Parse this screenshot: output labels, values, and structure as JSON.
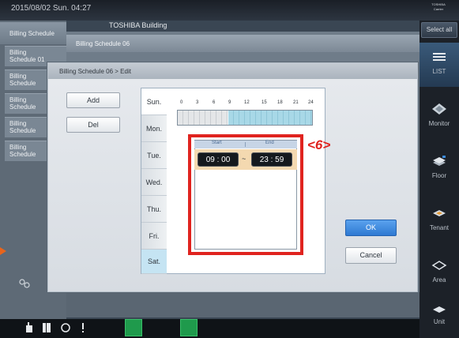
{
  "topbar": {
    "datetime": "2015/08/02  Sun.  04:27",
    "building": "TOSHIBA Building",
    "logo_lines": [
      "TOSHIBA",
      "Carrier"
    ]
  },
  "right_panel": {
    "select_all": "Select all",
    "nav": [
      {
        "label": "LIST",
        "icon": "list-icon"
      },
      {
        "label": "Monitor",
        "icon": "monitor-icon"
      },
      {
        "label": "Floor",
        "icon": "floor-icon"
      },
      {
        "label": "Tenant",
        "icon": "tenant-icon"
      },
      {
        "label": "Area",
        "icon": "area-icon"
      },
      {
        "label": "Unit",
        "icon": "unit-icon"
      }
    ]
  },
  "background": {
    "left_header": "Billing Schedule",
    "mid_title": "Billing Schedule 06",
    "items": [
      {
        "line1": "Billing",
        "line2": "Schedule 01"
      },
      {
        "line1": "Billing",
        "line2": "Schedule"
      },
      {
        "line1": "Billing",
        "line2": "Schedule"
      },
      {
        "line1": "Billing",
        "line2": "Schedule"
      },
      {
        "line1": "Billing",
        "line2": "Schedule"
      }
    ]
  },
  "dialog": {
    "title": "Billing Schedule 06 > Edit",
    "add_label": "Add",
    "del_label": "Del",
    "ok_label": "OK",
    "cancel_label": "Cancel",
    "days": [
      "Sun.",
      "Mon.",
      "Tue.",
      "Wed.",
      "Thu.",
      "Fri.",
      "Sat."
    ],
    "timeline_ticks": [
      "0",
      "3",
      "6",
      "9",
      "12",
      "15",
      "18",
      "21",
      "24"
    ],
    "schedule": {
      "header_start": "Start",
      "header_end": "End",
      "start_time": "09 : 00",
      "separator": "~",
      "end_time": "23 : 59"
    }
  },
  "annotation": {
    "callout": "<6>",
    "highlight_color": "#e0231f"
  },
  "colors": {
    "ok_button": "#2e79d2",
    "selected_day": "#c5e4f3",
    "active_period": "#f4d9b0"
  }
}
